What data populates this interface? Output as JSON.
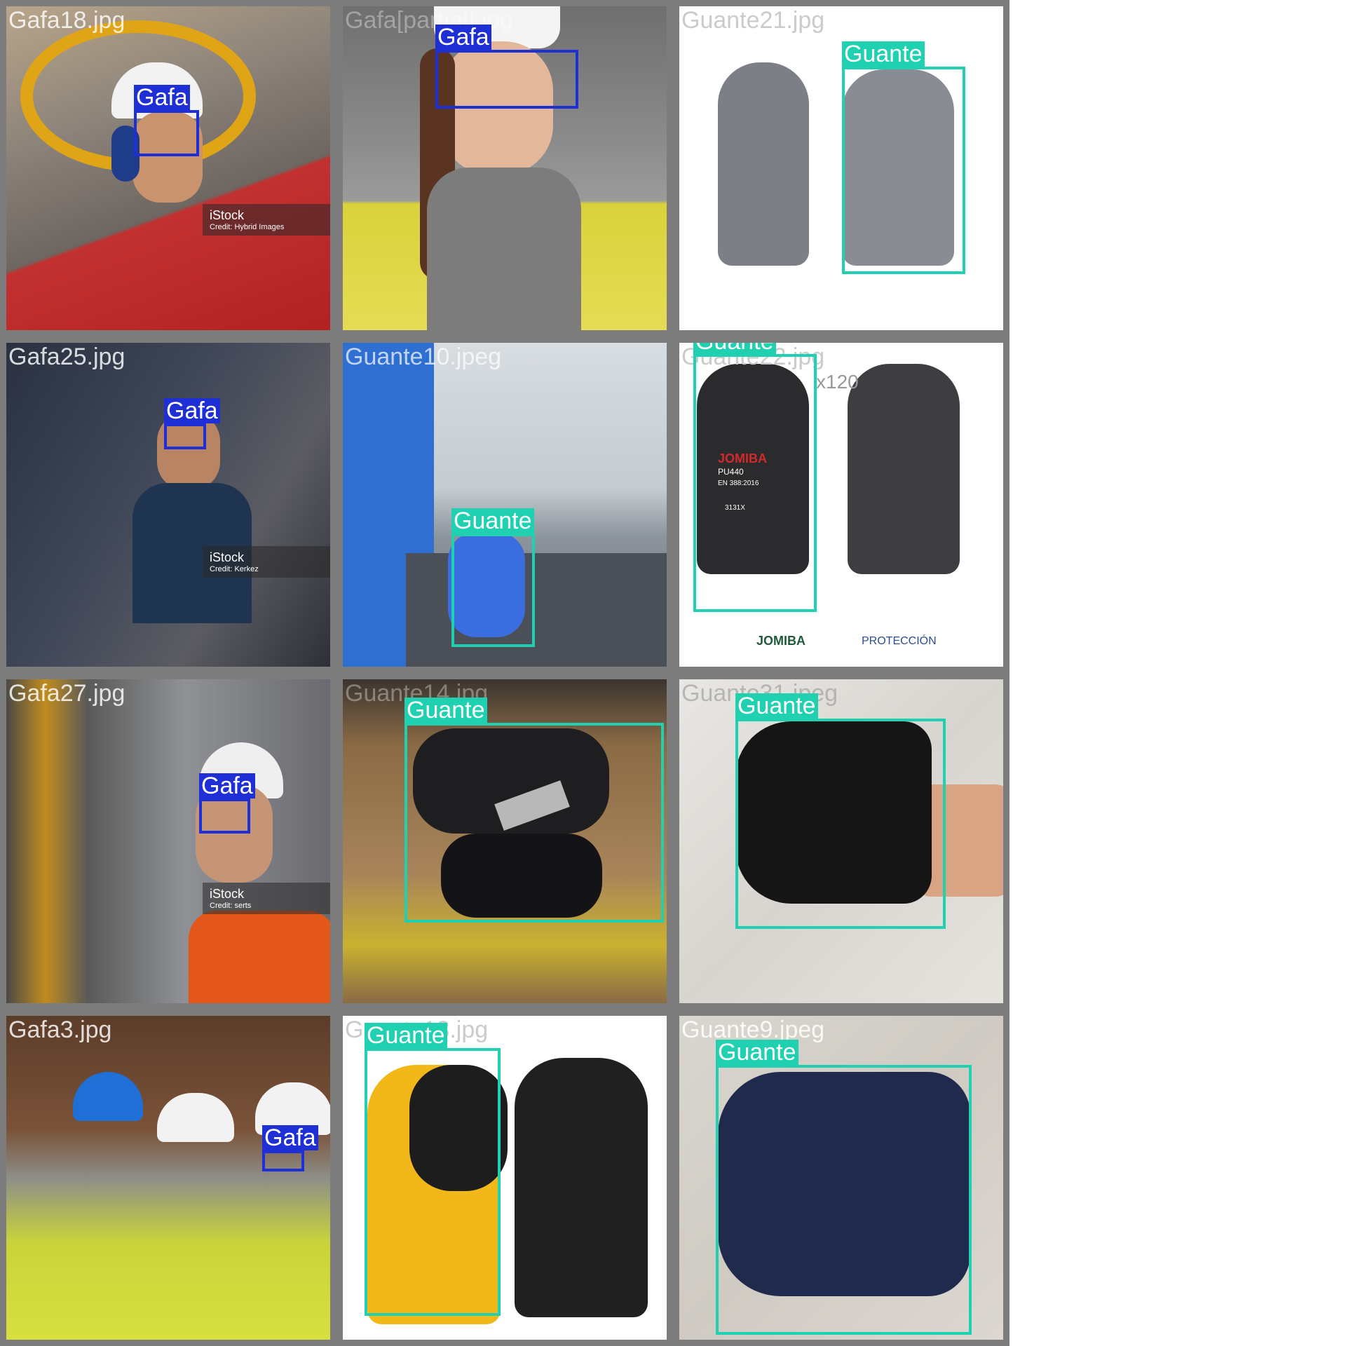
{
  "colors": {
    "gafa": "#1f2fd6",
    "guante": "#1fd1b0",
    "border": "#7d7d7d"
  },
  "tiles": [
    {
      "file": "Gafa18.jpg",
      "watermark": {
        "brand": "iStock",
        "credit": "Credit: Hybrid Images"
      },
      "detections": [
        {
          "label": "Gafa"
        }
      ]
    },
    {
      "file": "Gafa[partial].jpg",
      "detections": [
        {
          "label": "Gafa"
        }
      ]
    },
    {
      "file": "Guante21.jpg",
      "detections": [
        {
          "label": "Guante"
        }
      ]
    },
    {
      "file": "Gafa25.jpg",
      "watermark": {
        "brand": "iStock",
        "credit": "Credit: Kerkez"
      },
      "detections": [
        {
          "label": "Gafa"
        }
      ]
    },
    {
      "file": "Guante10.jpeg",
      "detections": [
        {
          "label": "Guante"
        }
      ]
    },
    {
      "file": "Guante22.jpg",
      "detections": [
        {
          "label": "Guante"
        }
      ],
      "product_text": {
        "brand": "JOMIBA",
        "model": "PU440",
        "standard": "EN 388:2016",
        "code": "3131X",
        "pack": "x120",
        "footer_brand": "JOMIBA",
        "footer_text": "PROTECCIÓN"
      }
    },
    {
      "file": "Gafa27.jpg",
      "watermark": {
        "brand": "iStock",
        "credit": "Credit: serts"
      },
      "detections": [
        {
          "label": "Gafa"
        }
      ]
    },
    {
      "file": "Guante14.jpg",
      "detections": [
        {
          "label": "Guante"
        }
      ]
    },
    {
      "file": "Guante31.jpeg",
      "detections": [
        {
          "label": "Guante"
        }
      ]
    },
    {
      "file": "Gafa3.jpg",
      "detections": [
        {
          "label": "Gafa"
        }
      ]
    },
    {
      "file": "Guante13.jpg",
      "detections": [
        {
          "label": "Guante"
        }
      ]
    },
    {
      "file": "Guante9.jpeg",
      "detections": [
        {
          "label": "Guante"
        }
      ]
    }
  ]
}
